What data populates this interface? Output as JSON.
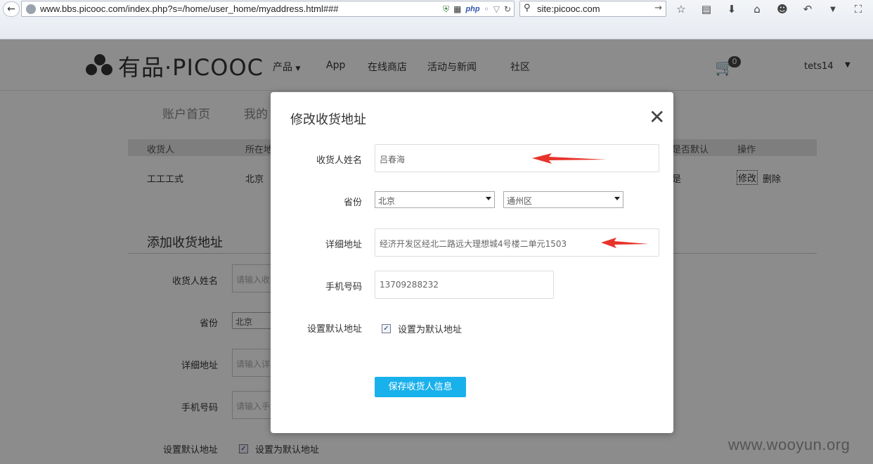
{
  "browser": {
    "url": "www.bbs.picooc.com/index.php?s=/home/user_home/myaddress.html###",
    "php_badge": "php",
    "search": "site:picooc.com",
    "toolbar_icons": [
      "star-icon",
      "clipboard-icon",
      "download-icon",
      "home-icon",
      "chat-icon",
      "undo-icon",
      "chevron-down-icon",
      "crop-icon",
      "chevron-down-icon"
    ]
  },
  "site": {
    "logo": "有品·PICOOC",
    "nav": [
      "产品",
      "App",
      "在线商店",
      "活动与新闻",
      "社区"
    ],
    "cart_count": "0",
    "username": "tets14",
    "account_tabs": [
      "账户首页",
      "我的"
    ],
    "table_headers": [
      "收货人",
      "所在地",
      "是否默认",
      "操作"
    ],
    "row": {
      "name": "工工工式",
      "region": "北京",
      "default": "是",
      "edit": "修改",
      "delete": "删除"
    },
    "add_form": {
      "title": "添加收货地址",
      "labels": [
        "收货人姓名",
        "省份",
        "详细地址",
        "手机号码",
        "设置默认地址"
      ],
      "placeholders": [
        "请输入收",
        "请输入详",
        "请输入手"
      ],
      "province": "北京",
      "default_label": "设置为默认地址"
    }
  },
  "modal": {
    "title": "修改收货地址",
    "close": "✕",
    "labels": {
      "name": "收货人姓名",
      "province": "省份",
      "address": "详细地址",
      "phone": "手机号码",
      "default": "设置默认地址"
    },
    "values": {
      "name": "吕春海",
      "province": "北京",
      "district": "通州区",
      "address": "经济开发区经北二路远大理想城4号楼二单元1503",
      "phone": "13709288232"
    },
    "default_checkbox_label": "设置为默认地址",
    "default_checked": true,
    "save_button": "保存收货人信息",
    "accent_color": "#19b1ec"
  },
  "watermark": "www.wooyun.org"
}
